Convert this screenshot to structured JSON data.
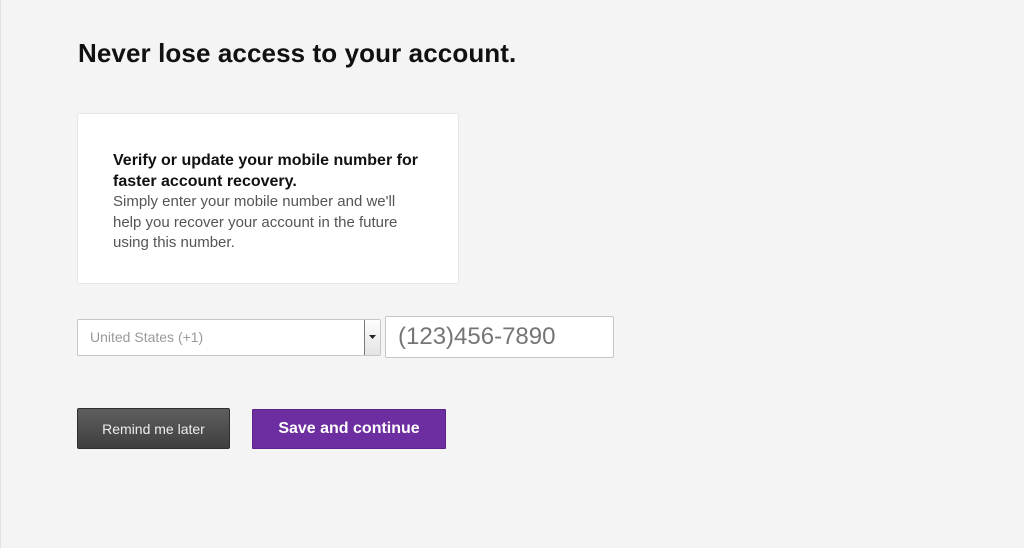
{
  "page": {
    "title": "Never lose access to your account."
  },
  "info_card": {
    "heading": "Verify or update your mobile number for faster account recovery.",
    "body": "Simply enter your mobile number and we'll help you recover your account in the future using this number."
  },
  "form": {
    "country_select": {
      "selected": "United States (+1)",
      "icon": "chevron-down-icon"
    },
    "phone_input": {
      "value": "",
      "placeholder": "(123)456-7890"
    }
  },
  "actions": {
    "remind_label": "Remind me later",
    "save_label": "Save and continue"
  },
  "colors": {
    "background": "#f4f4f4",
    "primary_purple": "#6c2ea0",
    "secondary_dark": "#4a4a4a"
  }
}
